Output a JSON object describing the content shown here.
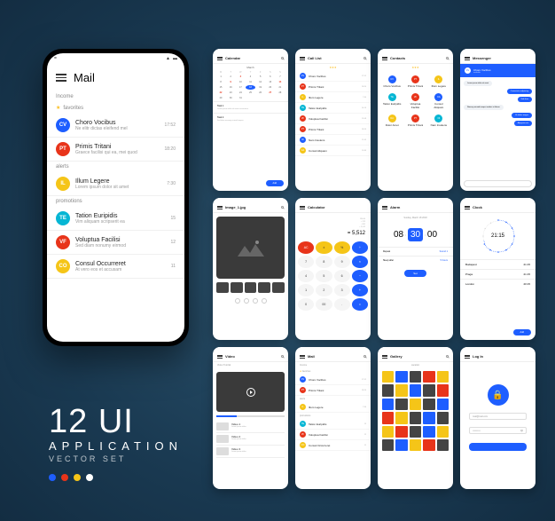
{
  "footer": {
    "title": "12 UI",
    "sub1": "APPLICATION",
    "sub2": "VECTOR SET"
  },
  "palette": [
    "#1e5eff",
    "#e8341a",
    "#f5c518",
    "#ffffff"
  ],
  "mail": {
    "title": "Mail",
    "sections": {
      "income": "Income",
      "favorites": "favorites",
      "alerts": "alerts",
      "promotions": "promotions"
    },
    "items": [
      {
        "avatar": "CV",
        "color": "c-blue",
        "name": "Choro Vocibus",
        "preview": "Ne elitr dictas eleifend mel",
        "time": "17:52"
      },
      {
        "avatar": "PT",
        "color": "c-red",
        "name": "Primis Tritani",
        "preview": "Graece facilisi qui ea, mei quod",
        "time": "18:20"
      },
      {
        "avatar": "IL",
        "color": "c-yellow",
        "name": "Illum Legere",
        "preview": "Lorem ipsum dolor sit amet",
        "time": "7:30"
      },
      {
        "avatar": "TE",
        "color": "c-cyan",
        "name": "Tation Euripidis",
        "preview": "Vim aliquam scripserit ea",
        "time": "15"
      },
      {
        "avatar": "VF",
        "color": "c-red",
        "name": "Voluptua Facilisi",
        "preview": "Sed diam nonumy eirmod",
        "time": "12"
      },
      {
        "avatar": "CO",
        "color": "c-yellow",
        "name": "Consul Occurreret",
        "preview": "At vero eos et accusam",
        "time": "11"
      }
    ]
  },
  "calendar": {
    "title": "Calendar",
    "month": "March",
    "days": [
      "M",
      "T",
      "W",
      "T",
      "F",
      "S",
      "S"
    ],
    "tasks": [
      {
        "t": "Task 1",
        "d": "Lorem ipsum dolor sit amet consectetur"
      },
      {
        "t": "Task 2",
        "d": "Sed diam nonumy eirmod tempor"
      }
    ],
    "add": "Add"
  },
  "calllist": {
    "title": "Call List",
    "items": [
      {
        "a": "CV",
        "c": "c-blue",
        "n": "Choro Vocibus",
        "t": "17:52"
      },
      {
        "a": "PT",
        "c": "c-red",
        "n": "Primis Tritani",
        "t": "18:20"
      },
      {
        "a": "IL",
        "c": "c-yellow",
        "n": "Illum Legere",
        "t": "7:30"
      },
      {
        "a": "TE",
        "c": "c-cyan",
        "n": "Tation Euripidis",
        "t": "14:13"
      },
      {
        "a": "VF",
        "c": "c-red",
        "n": "Voluptua Facilisi",
        "t": "12:08"
      },
      {
        "a": "PT",
        "c": "c-red",
        "n": "Primis Tritani",
        "t": "18:20"
      },
      {
        "a": "NI",
        "c": "c-blue",
        "n": "Nam Insolens",
        "t": "11:45"
      },
      {
        "a": "CA",
        "c": "c-yellow",
        "n": "Consul Aliquam",
        "t": "10:30"
      }
    ]
  },
  "contacts": {
    "title": "Contacts",
    "items": [
      {
        "a": "CV",
        "c": "c-blue",
        "n": "Choro Vocibus"
      },
      {
        "a": "PT",
        "c": "c-red",
        "n": "Primis Tritani"
      },
      {
        "a": "IL",
        "c": "c-yellow",
        "n": "Illum Legere"
      },
      {
        "a": "TE",
        "c": "c-cyan",
        "n": "Tation Euripidis"
      },
      {
        "a": "VF",
        "c": "c-red",
        "n": "Voluptua Facilisi"
      },
      {
        "a": "CA",
        "c": "c-blue",
        "n": "Consul Aliquam"
      },
      {
        "a": "DA",
        "c": "c-yellow",
        "n": "Dolor Amet"
      },
      {
        "a": "PT",
        "c": "c-red",
        "n": "Primis Tritani"
      },
      {
        "a": "NI",
        "c": "c-cyan",
        "n": "Nam Insolens"
      }
    ]
  },
  "messenger": {
    "title": "Messenger",
    "user": "Choro Vocibus",
    "status": "available",
    "msgs": [
      {
        "dir": "in",
        "t": "Lorem ipsum dolor sit amet"
      },
      {
        "dir": "out",
        "t": "Consectetur adipiscing"
      },
      {
        "dir": "out",
        "t": "Sed diam"
      },
      {
        "dir": "in",
        "t": "Nonumy eirmod tempor invidunt ut labore"
      },
      {
        "dir": "out",
        "t": "Et dolore magna"
      },
      {
        "dir": "out",
        "t": "Aliquyam erat"
      }
    ]
  },
  "image": {
    "title": "Image_1.jpg"
  },
  "calculator": {
    "title": "Calculator",
    "history": [
      "130.00",
      "+ 373",
      "- 891",
      "+ 5,512"
    ],
    "result": "= 5,512",
    "keys": [
      {
        "l": "AC",
        "c": "fn"
      },
      {
        "l": "±",
        "c": "fn2"
      },
      {
        "l": "%",
        "c": "fn2"
      },
      {
        "l": "÷",
        "c": "op"
      },
      {
        "l": "7"
      },
      {
        "l": "8"
      },
      {
        "l": "9"
      },
      {
        "l": "×",
        "c": "op"
      },
      {
        "l": "4"
      },
      {
        "l": "5"
      },
      {
        "l": "6"
      },
      {
        "l": "−",
        "c": "op"
      },
      {
        "l": "1"
      },
      {
        "l": "2"
      },
      {
        "l": "3"
      },
      {
        "l": "+",
        "c": "op"
      },
      {
        "l": "0"
      },
      {
        "l": "00"
      },
      {
        "l": "."
      },
      {
        "l": "=",
        "c": "op"
      }
    ]
  },
  "alarm": {
    "title": "Alarm",
    "date": "Sunday, March 18 2018",
    "h": "08",
    "m": "30",
    "s": "00",
    "rows": [
      {
        "l": "Repeat",
        "v": "Sound 1"
      },
      {
        "l": "Sleep after",
        "v": "5 hours"
      }
    ],
    "set": "Set"
  },
  "clock": {
    "title": "Clock",
    "time": "21:15",
    "zones": [
      {
        "c": "Budapest",
        "t": "21:15"
      },
      {
        "c": "Praga",
        "t": "21:15"
      },
      {
        "c": "London",
        "t": "20:15"
      }
    ],
    "add": "Add"
  },
  "video": {
    "title": "Video",
    "heading": "Video Tutorial",
    "items": [
      {
        "n": "Video 1"
      },
      {
        "n": "Video 2"
      },
      {
        "n": "Video 3"
      }
    ]
  },
  "gallery": {
    "title": "Gallery",
    "section": "vacation"
  },
  "login": {
    "title": "Log In",
    "email": "mail@mail.com",
    "password": "••••••••••"
  }
}
